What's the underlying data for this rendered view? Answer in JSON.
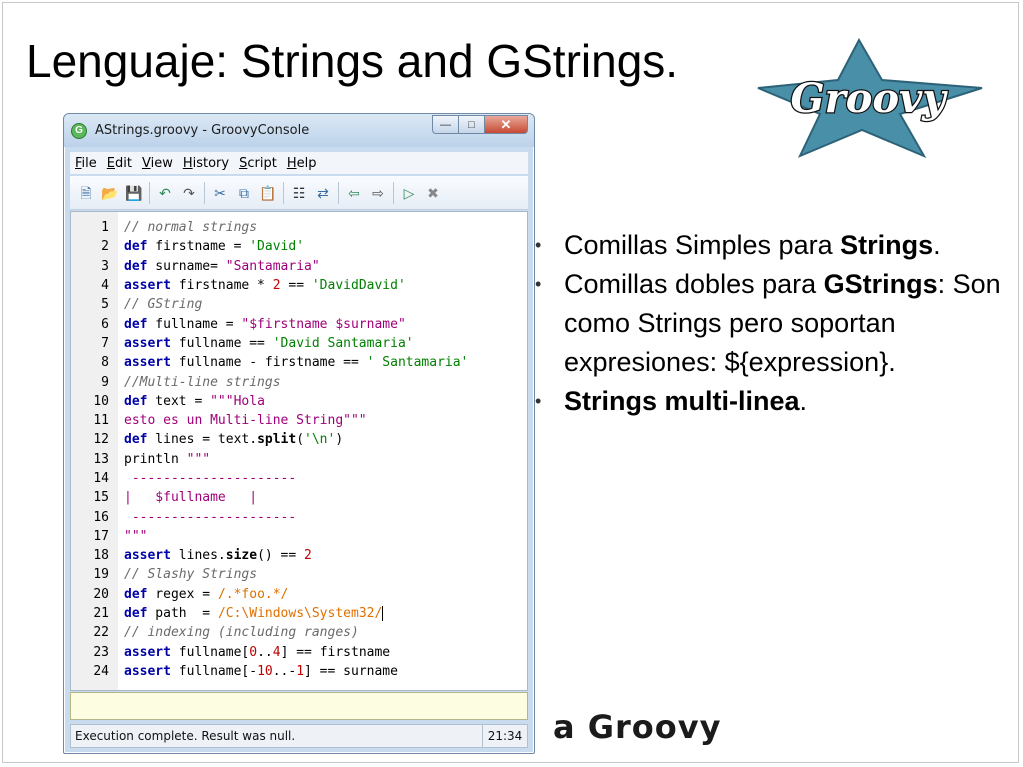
{
  "slide": {
    "title": "Lenguaje: Strings and GStrings.",
    "footer_logo_text": "a Groovy"
  },
  "window": {
    "title": "AStrings.groovy - GroovyConsole",
    "menu": [
      "File",
      "Edit",
      "View",
      "History",
      "Script",
      "Help"
    ],
    "toolbar_icons": [
      "new-file-icon",
      "open-file-icon",
      "save-icon",
      "sep",
      "undo-icon",
      "redo-icon",
      "sep",
      "cut-icon",
      "copy-icon",
      "paste-icon",
      "sep",
      "find-icon",
      "replace-icon",
      "sep",
      "history-prev-icon",
      "history-next-icon",
      "sep",
      "run-icon",
      "interrupt-icon"
    ],
    "status_text": "Execution complete. Result was null.",
    "cursor_position": "21:34"
  },
  "code": [
    {
      "n": "1",
      "tokens": [
        [
          "cm",
          "// normal strings"
        ]
      ]
    },
    {
      "n": "2",
      "tokens": [
        [
          "kw",
          "def"
        ],
        [
          "tx",
          " firstname = "
        ],
        [
          "st",
          "'David'"
        ]
      ]
    },
    {
      "n": "3",
      "tokens": [
        [
          "kw",
          "def"
        ],
        [
          "tx",
          " surname= "
        ],
        [
          "gs",
          "\"Santamaria\""
        ]
      ]
    },
    {
      "n": "4",
      "tokens": [
        [
          "kw",
          "assert"
        ],
        [
          "tx",
          " firstname * "
        ],
        [
          "nm",
          "2"
        ],
        [
          "tx",
          " == "
        ],
        [
          "st",
          "'DavidDavid'"
        ]
      ]
    },
    {
      "n": "5",
      "tokens": [
        [
          "cm",
          "// GString"
        ]
      ]
    },
    {
      "n": "6",
      "tokens": [
        [
          "kw",
          "def"
        ],
        [
          "tx",
          " fullname = "
        ],
        [
          "gs",
          "\"$firstname $surname\""
        ]
      ]
    },
    {
      "n": "7",
      "tokens": [
        [
          "kw",
          "assert"
        ],
        [
          "tx",
          " fullname == "
        ],
        [
          "st",
          "'David Santamaria'"
        ]
      ]
    },
    {
      "n": "8",
      "tokens": [
        [
          "kw",
          "assert"
        ],
        [
          "tx",
          " fullname - firstname == "
        ],
        [
          "st",
          "' Santamaria'"
        ]
      ]
    },
    {
      "n": "9",
      "tokens": [
        [
          "cm",
          "//Multi-line strings"
        ]
      ]
    },
    {
      "n": "10",
      "tokens": [
        [
          "kw",
          "def"
        ],
        [
          "tx",
          " text = "
        ],
        [
          "gs",
          "\"\"\"Hola"
        ]
      ]
    },
    {
      "n": "11",
      "tokens": [
        [
          "gs",
          "esto es un Multi-line String\"\"\""
        ]
      ]
    },
    {
      "n": "12",
      "tokens": [
        [
          "kw",
          "def"
        ],
        [
          "tx",
          " lines = text."
        ],
        [
          "fn",
          "split"
        ],
        [
          "tx",
          "("
        ],
        [
          "st",
          "'\\n'"
        ],
        [
          "tx",
          ")"
        ]
      ]
    },
    {
      "n": "13",
      "tokens": [
        [
          "tx",
          "println "
        ],
        [
          "gs",
          "\"\"\""
        ]
      ]
    },
    {
      "n": "14",
      "tokens": [
        [
          "gs",
          " ---------------------"
        ]
      ]
    },
    {
      "n": "15",
      "tokens": [
        [
          "gs",
          "|   $fullname   |"
        ]
      ]
    },
    {
      "n": "16",
      "tokens": [
        [
          "gs",
          " ---------------------"
        ]
      ]
    },
    {
      "n": "17",
      "tokens": [
        [
          "gs",
          "\"\"\""
        ]
      ]
    },
    {
      "n": "18",
      "tokens": [
        [
          "kw",
          "assert"
        ],
        [
          "tx",
          " lines."
        ],
        [
          "fn",
          "size"
        ],
        [
          "tx",
          "() == "
        ],
        [
          "nm",
          "2"
        ]
      ]
    },
    {
      "n": "19",
      "tokens": [
        [
          "cm",
          "// Slashy Strings"
        ]
      ]
    },
    {
      "n": "20",
      "tokens": [
        [
          "kw",
          "def"
        ],
        [
          "tx",
          " regex = "
        ],
        [
          "rx",
          "/.*foo.*/"
        ]
      ]
    },
    {
      "n": "21",
      "tokens": [
        [
          "kw",
          "def"
        ],
        [
          "tx",
          " path  = "
        ],
        [
          "rx",
          "/C:\\Windows\\System32/"
        ],
        [
          "caret",
          ""
        ]
      ]
    },
    {
      "n": "22",
      "tokens": [
        [
          "cm",
          "// indexing (including ranges)"
        ]
      ]
    },
    {
      "n": "23",
      "tokens": [
        [
          "kw",
          "assert"
        ],
        [
          "tx",
          " fullname["
        ],
        [
          "nm",
          "0"
        ],
        [
          "tx",
          ".."
        ],
        [
          "nm",
          "4"
        ],
        [
          "tx",
          "] == firstname"
        ]
      ]
    },
    {
      "n": "24",
      "tokens": [
        [
          "kw",
          "assert"
        ],
        [
          "tx",
          " fullname[-"
        ],
        [
          "nm",
          "10"
        ],
        [
          "tx",
          "..-"
        ],
        [
          "nm",
          "1"
        ],
        [
          "tx",
          "] == surname"
        ]
      ]
    }
  ],
  "bullets": [
    [
      [
        "n",
        "Comillas Simples para "
      ],
      [
        "b",
        "Strings"
      ],
      [
        "n",
        "."
      ]
    ],
    [
      [
        "n",
        "Comillas dobles para "
      ],
      [
        "b",
        "GStrings"
      ],
      [
        "n",
        ": Son como Strings pero soportan expresiones: ${expression}."
      ]
    ],
    [
      [
        "b",
        "Strings multi-linea"
      ],
      [
        "n",
        "."
      ]
    ]
  ],
  "colors": {
    "keyword": "#0000a8",
    "string": "#008000",
    "gstring": "#a0007a",
    "number": "#c00000",
    "regex": "#e07000",
    "comment": "#6a6a6a",
    "logo_star": "#4a8fa8"
  },
  "logo_text": "Groovy"
}
